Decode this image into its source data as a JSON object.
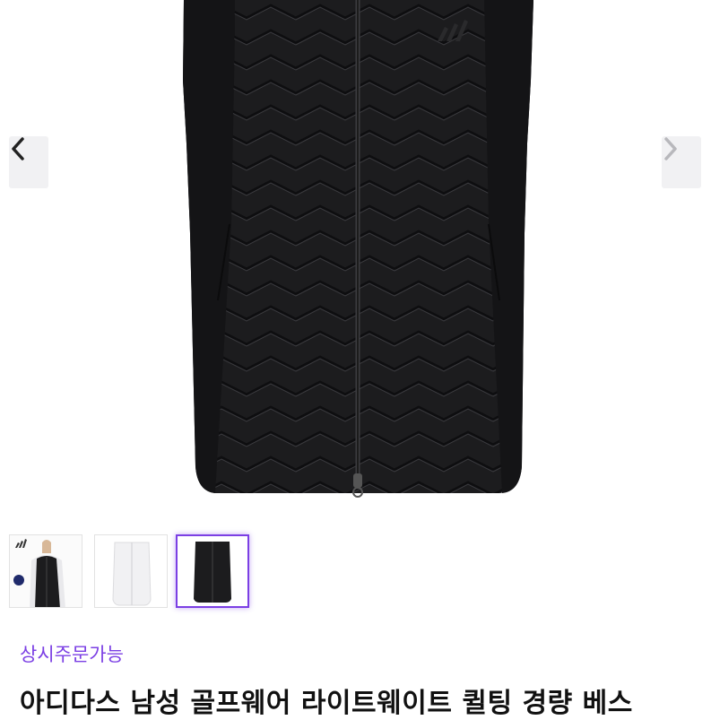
{
  "product": {
    "main_image": "black-quilted-golf-vest",
    "status_label": "상시주문가능",
    "title": "아디다스 남성 골프웨어 라이트웨이트 퀼팅 경량 베스"
  },
  "gallery": {
    "prev_icon": "chevron-left-icon",
    "next_icon": "chevron-right-icon",
    "thumbnails": [
      {
        "subject": "model-wearing-black-vest",
        "selected": false
      },
      {
        "subject": "white-vest",
        "selected": false
      },
      {
        "subject": "black-vest",
        "selected": true
      }
    ]
  },
  "colors": {
    "accent": "#7b3fe4",
    "vest": "#1c1c1e",
    "nav_bg": "#f1f1f3"
  }
}
